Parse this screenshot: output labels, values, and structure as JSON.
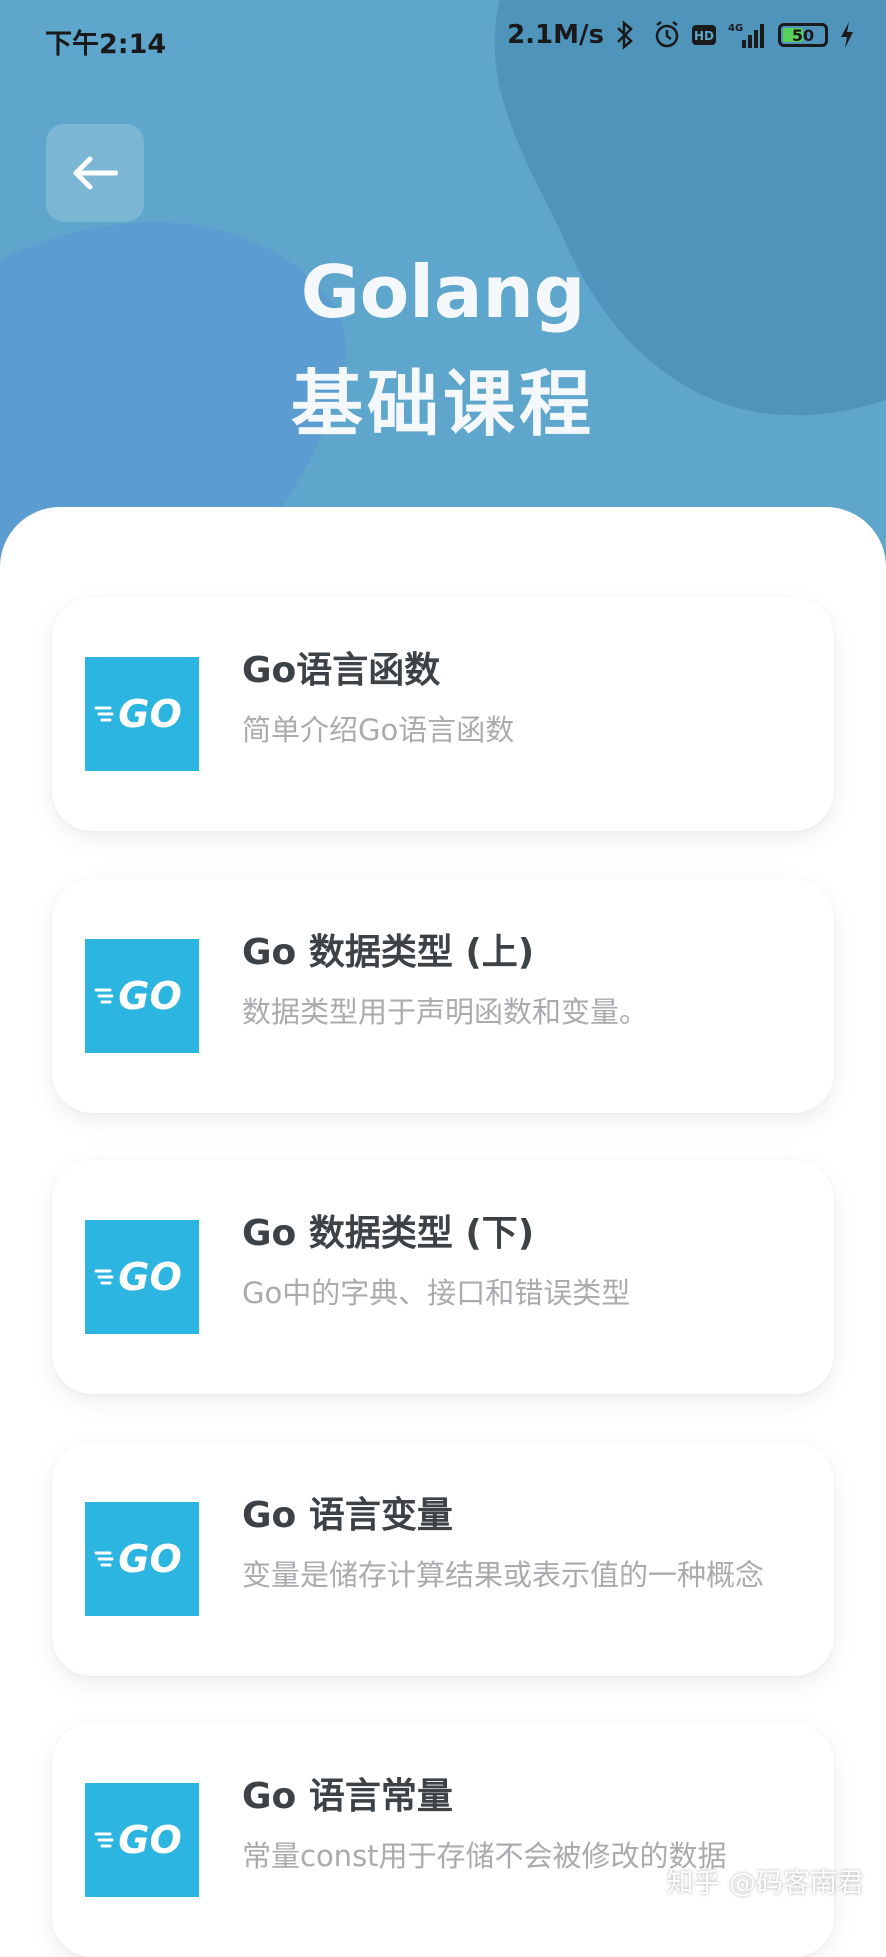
{
  "status_bar": {
    "time": "下午2:14",
    "network_speed": "2.1M/s",
    "battery_level": "50",
    "icons": [
      "bluetooth-icon",
      "alarm-icon",
      "hd-icon",
      "signal-4g-icon",
      "battery-icon",
      "charging-icon"
    ]
  },
  "header": {
    "title_line1": "Golang",
    "title_line2": "基础课程",
    "back_icon": "arrow-left-icon"
  },
  "courses": [
    {
      "title": "Go语言函数",
      "description": "简单介绍Go语言函数",
      "logo": "GO"
    },
    {
      "title": "Go 数据类型 (上)",
      "description": "数据类型用于声明函数和变量。",
      "logo": "GO"
    },
    {
      "title": "Go 数据类型 (下)",
      "description": "Go中的字典、接口和错误类型",
      "logo": "GO"
    },
    {
      "title": "Go 语言变量",
      "description": "变量是储存计算结果或表示值的一种概念",
      "logo": "GO"
    },
    {
      "title": "Go 语言常量",
      "description": "常量const用于存储不会被修改的数据",
      "logo": "GO"
    }
  ],
  "watermark": "知乎 @码客南君",
  "colors": {
    "header_blue": "#5fa6cc",
    "logo_blue": "#2bb5e0",
    "title_text": "#3d4247",
    "desc_text": "#a9abae"
  }
}
